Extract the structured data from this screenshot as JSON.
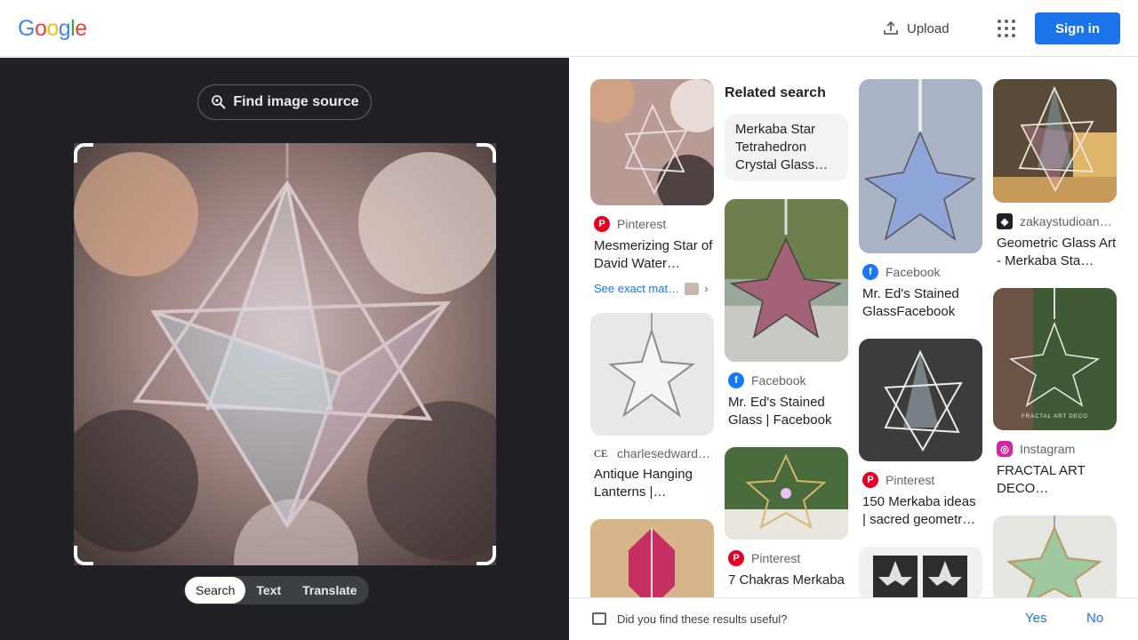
{
  "header": {
    "logo_letters": [
      {
        "ch": "G",
        "color": "#4285F4"
      },
      {
        "ch": "o",
        "color": "#EA4335"
      },
      {
        "ch": "o",
        "color": "#FBBC05"
      },
      {
        "ch": "g",
        "color": "#4285F4"
      },
      {
        "ch": "l",
        "color": "#34A853"
      },
      {
        "ch": "e",
        "color": "#EA4335"
      }
    ],
    "upload_label": "Upload",
    "apps_icon": "apps-grid-icon",
    "signin_label": "Sign in"
  },
  "left": {
    "find_source_label": "Find image source",
    "modes": [
      "Search",
      "Text",
      "Translate"
    ],
    "active_mode": "Search"
  },
  "results": {
    "col1": [
      {
        "source": "Pinterest",
        "source_icon": "pinterest-icon",
        "title": "Mesmerizing Star of David Water…",
        "exact_label": "See exact mat…"
      },
      {
        "source": "charlesedward…",
        "source_icon": "ce-logo-icon",
        "source_badge": "CE",
        "title": "Antique Hanging Lanterns | Bespok…"
      },
      {
        "source": "",
        "title": ""
      }
    ],
    "related": {
      "heading": "Related search",
      "chip": "Merkaba Star Tetrahedron Crystal Glass…"
    },
    "col2": [
      {
        "source": "Facebook",
        "source_icon": "facebook-icon",
        "title": "Mr. Ed's Stained Glass | Facebook"
      },
      {
        "source": "Pinterest",
        "source_icon": "pinterest-icon",
        "title": "7 Chakras Merkaba"
      }
    ],
    "col3": [
      {
        "source": "Facebook",
        "source_icon": "facebook-icon",
        "title": "Mr. Ed's Stained GlassFacebook"
      },
      {
        "source": "Pinterest",
        "source_icon": "pinterest-icon",
        "title": "150 Merkaba ideas | sacred geometr…"
      },
      {
        "source": "",
        "title": ""
      }
    ],
    "col4": [
      {
        "source": "zakaystudioan…",
        "source_icon": "zakay-logo-icon",
        "title": "Geometric Glass Art - Merkaba Sta…"
      },
      {
        "source": "Instagram",
        "source_icon": "instagram-icon",
        "title": "FRACTAL ART DECO…",
        "thumb_caption": "FRACTAL ART DECO"
      },
      {
        "source": "",
        "title": ""
      }
    ]
  },
  "feedback": {
    "question": "Did you find these results useful?",
    "yes": "Yes",
    "no": "No"
  },
  "colors": {
    "accent": "#1a73e8",
    "dark_panel": "#202124",
    "pinterest": "#e60023",
    "facebook": "#1877f2"
  }
}
